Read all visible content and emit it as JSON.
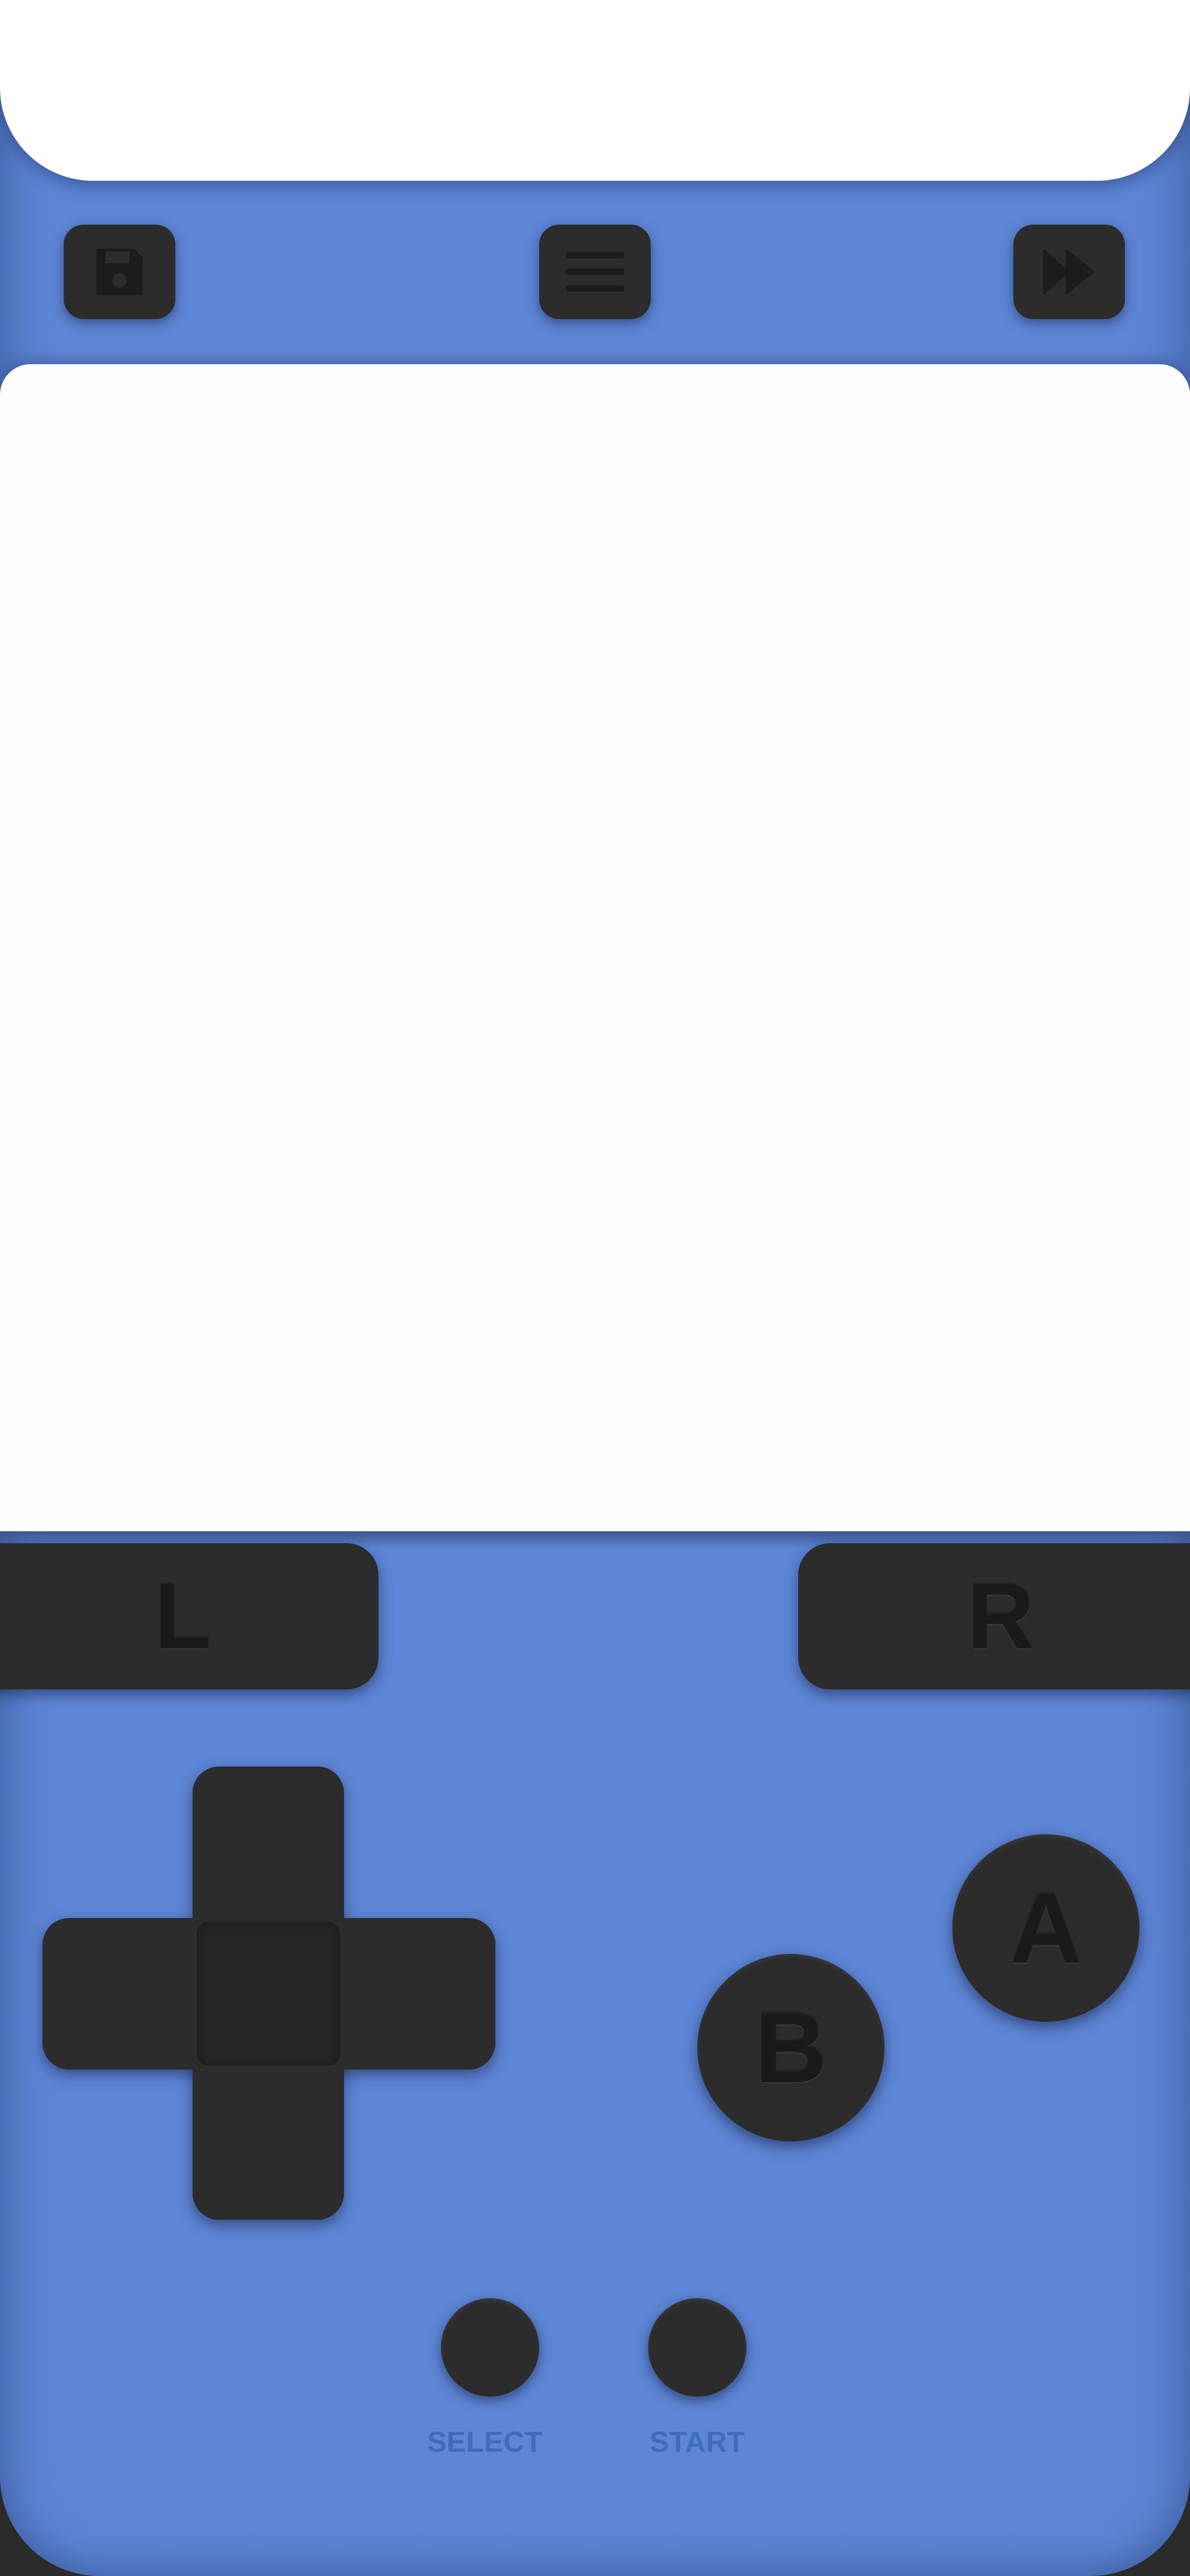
{
  "toolbar": {
    "save_icon": "floppy-disk-icon",
    "menu_icon": "hamburger-menu-icon",
    "fast_forward_icon": "fast-forward-icon"
  },
  "controls": {
    "l_label": "L",
    "r_label": "R",
    "a_label": "A",
    "b_label": "B",
    "select_label": "SELECT",
    "start_label": "START"
  },
  "colors": {
    "body": "#5e86d6",
    "button": "#2c2c2c",
    "label_text": "#3f6dbb",
    "screen": "#fdfdfd"
  }
}
